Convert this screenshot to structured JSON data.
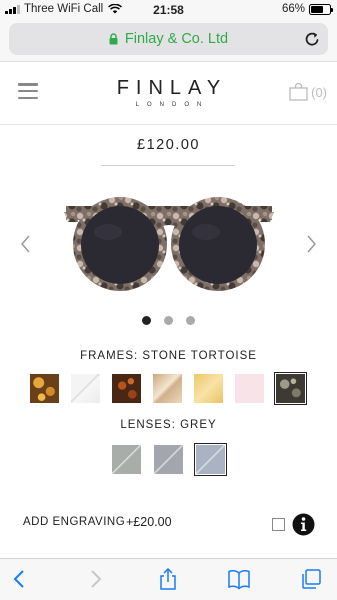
{
  "status_bar": {
    "carrier": "Three WiFi Call",
    "time": "21:58",
    "battery": "66%",
    "battery_level": 0.66
  },
  "browser": {
    "url_display": "Finlay & Co. Ltd",
    "secure": true,
    "url_color": "#2eaa4a"
  },
  "header": {
    "logo_main": "FINLAY",
    "logo_sub": "LONDON",
    "cart_count": "(0)"
  },
  "product": {
    "price": "£120.00",
    "image_count": 3,
    "active_image": 0,
    "frames_label": "FRAMES: STONE TORTOISE",
    "frame_options": [
      {
        "name": "tortoise",
        "color": "#6b3f17",
        "selected": false
      },
      {
        "name": "clear",
        "color": "#e8e8e8",
        "selected": false
      },
      {
        "name": "dark-tortoise",
        "color": "#4a2614",
        "selected": false
      },
      {
        "name": "champagne",
        "color": "#dcc3a0",
        "selected": false
      },
      {
        "name": "honey",
        "color": "#f0d58a",
        "selected": false
      },
      {
        "name": "blush",
        "color": "#f7e3e8",
        "selected": false
      },
      {
        "name": "stone-tortoise",
        "color": "#3c3a33",
        "selected": true
      }
    ],
    "lenses_label": "LENSES: GREY",
    "lens_options": [
      {
        "name": "green-grey",
        "color": "#a9ada9",
        "selected": false
      },
      {
        "name": "slate",
        "color": "#a4a6ae",
        "selected": false
      },
      {
        "name": "grey",
        "color": "#a9b3c3",
        "selected": true
      }
    ],
    "engraving_label": "ADD ENGRAVING",
    "engraving_price": "+£20.00"
  },
  "toolbar": {
    "icons": [
      "back-icon",
      "forward-icon",
      "share-icon",
      "bookmarks-icon",
      "tabs-icon"
    ]
  }
}
